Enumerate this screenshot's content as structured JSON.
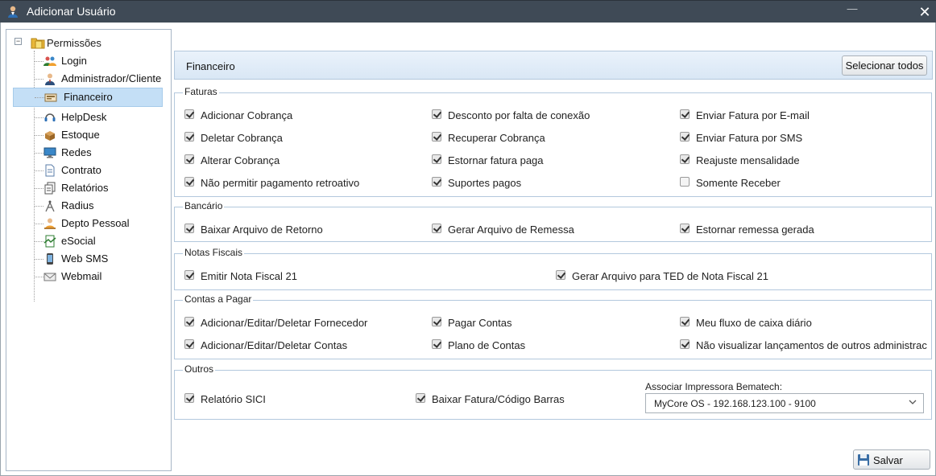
{
  "window": {
    "title": "Adicionar Usuário",
    "minimize_label": "—",
    "close_label": "✕"
  },
  "tree": {
    "root_label": "Permissões",
    "expander": "−",
    "items": [
      {
        "label": "Login",
        "icon": "users-icon"
      },
      {
        "label": "Administrador/Cliente",
        "icon": "admin-user-icon"
      },
      {
        "label": "Financeiro",
        "icon": "cash-register-icon",
        "selected": true
      },
      {
        "label": "HelpDesk",
        "icon": "headset-icon"
      },
      {
        "label": "Estoque",
        "icon": "box-icon"
      },
      {
        "label": "Redes",
        "icon": "monitor-icon"
      },
      {
        "label": "Contrato",
        "icon": "document-icon"
      },
      {
        "label": "Relatórios",
        "icon": "report-icon"
      },
      {
        "label": "Radius",
        "icon": "antenna-icon"
      },
      {
        "label": "Depto Pessoal",
        "icon": "staff-icon"
      },
      {
        "label": "eSocial",
        "icon": "esocial-icon"
      },
      {
        "label": "Web SMS",
        "icon": "phone-icon"
      },
      {
        "label": "Webmail",
        "icon": "mail-icon"
      }
    ]
  },
  "panel": {
    "title": "Financeiro",
    "select_all_label": "Selecionar todos"
  },
  "groups": {
    "faturas": {
      "legend": "Faturas",
      "items": [
        {
          "label": "Adicionar Cobrança",
          "checked": true
        },
        {
          "label": "Desconto por falta de conexão",
          "checked": true
        },
        {
          "label": "Enviar Fatura por E-mail",
          "checked": true
        },
        {
          "label": "Deletar Cobrança",
          "checked": true
        },
        {
          "label": "Recuperar Cobrança",
          "checked": true
        },
        {
          "label": "Enviar Fatura por SMS",
          "checked": true
        },
        {
          "label": "Alterar Cobrança",
          "checked": true
        },
        {
          "label": "Estornar fatura paga",
          "checked": true
        },
        {
          "label": "Reajuste mensalidade",
          "checked": true
        },
        {
          "label": "Não permitir pagamento retroativo",
          "checked": true
        },
        {
          "label": "Suportes pagos",
          "checked": true
        },
        {
          "label": "Somente Receber",
          "checked": false
        }
      ]
    },
    "bancario": {
      "legend": "Bancário",
      "items": [
        {
          "label": "Baixar Arquivo de Retorno",
          "checked": true
        },
        {
          "label": "Gerar Arquivo de Remessa",
          "checked": true
        },
        {
          "label": "Estornar remessa gerada",
          "checked": true
        }
      ]
    },
    "notas": {
      "legend": "Notas Fiscais",
      "items": [
        {
          "label": "Emitir Nota Fiscal 21",
          "checked": true
        },
        {
          "label": "Gerar Arquivo para TED de Nota Fiscal 21",
          "checked": true
        }
      ]
    },
    "contas": {
      "legend": "Contas a Pagar",
      "items": [
        {
          "label": "Adicionar/Editar/Deletar Fornecedor",
          "checked": true
        },
        {
          "label": "Pagar Contas",
          "checked": true
        },
        {
          "label": "Meu fluxo de caixa diário",
          "checked": true
        },
        {
          "label": "Adicionar/Editar/Deletar Contas",
          "checked": true
        },
        {
          "label": "Plano de Contas",
          "checked": true
        },
        {
          "label": "Não visualizar lançamentos de outros administrac",
          "checked": true
        }
      ]
    },
    "outros": {
      "legend": "Outros",
      "items": [
        {
          "label": "Relatório SICI",
          "checked": true
        },
        {
          "label": "Baixar Fatura/Código Barras",
          "checked": true
        }
      ],
      "printer_label": "Associar Impressora Bematech:",
      "printer_value": "MyCore OS - 192.168.123.100 - 9100"
    }
  },
  "footer": {
    "save_label": "Salvar"
  }
}
